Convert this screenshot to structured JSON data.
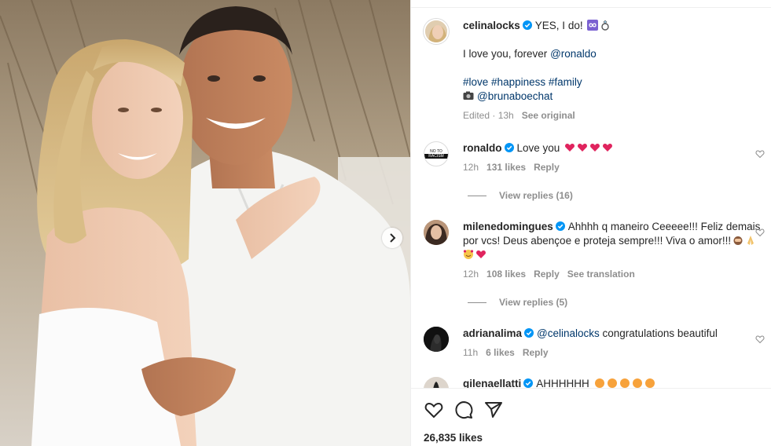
{
  "caption": {
    "username": "celinalocks",
    "text": "YES, I do!",
    "line2_prefix": "I love you, forever ",
    "line2_mention": "@ronaldo",
    "hashtags": [
      "#love",
      "#happiness",
      "#family"
    ],
    "photo_credit": "@brunaboechat",
    "edited": "Edited · 13h",
    "see_original": "See original"
  },
  "comments": [
    {
      "username": "ronaldo",
      "text": "Love you",
      "time": "12h",
      "likes": "131 likes",
      "reply": "Reply",
      "replies": "View replies (16)",
      "avatar_text": [
        "NO TO",
        "RACISM"
      ]
    },
    {
      "username": "milenedomingues",
      "text": "Ahhhh q maneiro Ceeeee!!! Feliz demais por vcs! Deus abençoe e proteja sempre!!! Viva o amor!!!",
      "time": "12h",
      "likes": "108 likes",
      "reply": "Reply",
      "translate": "See translation",
      "replies": "View replies (5)"
    },
    {
      "username": "adrianalima",
      "mention": "@celinalocks",
      "text": " congratulations beautiful",
      "time": "11h",
      "likes": "6 likes",
      "reply": "Reply"
    },
    {
      "username": "gilenaellatti",
      "text": "AHHHHHH"
    }
  ],
  "likes_count": "26,835 likes",
  "icons": {
    "verified": "verified-badge-icon",
    "like": "heart-icon",
    "comment": "comment-bubble-icon",
    "share": "paper-plane-icon",
    "next": "chevron-right-icon"
  },
  "colors": {
    "link": "#00376b",
    "verified": "#0095f6",
    "meta": "#8e8e8e",
    "heart": "#e0245e"
  }
}
